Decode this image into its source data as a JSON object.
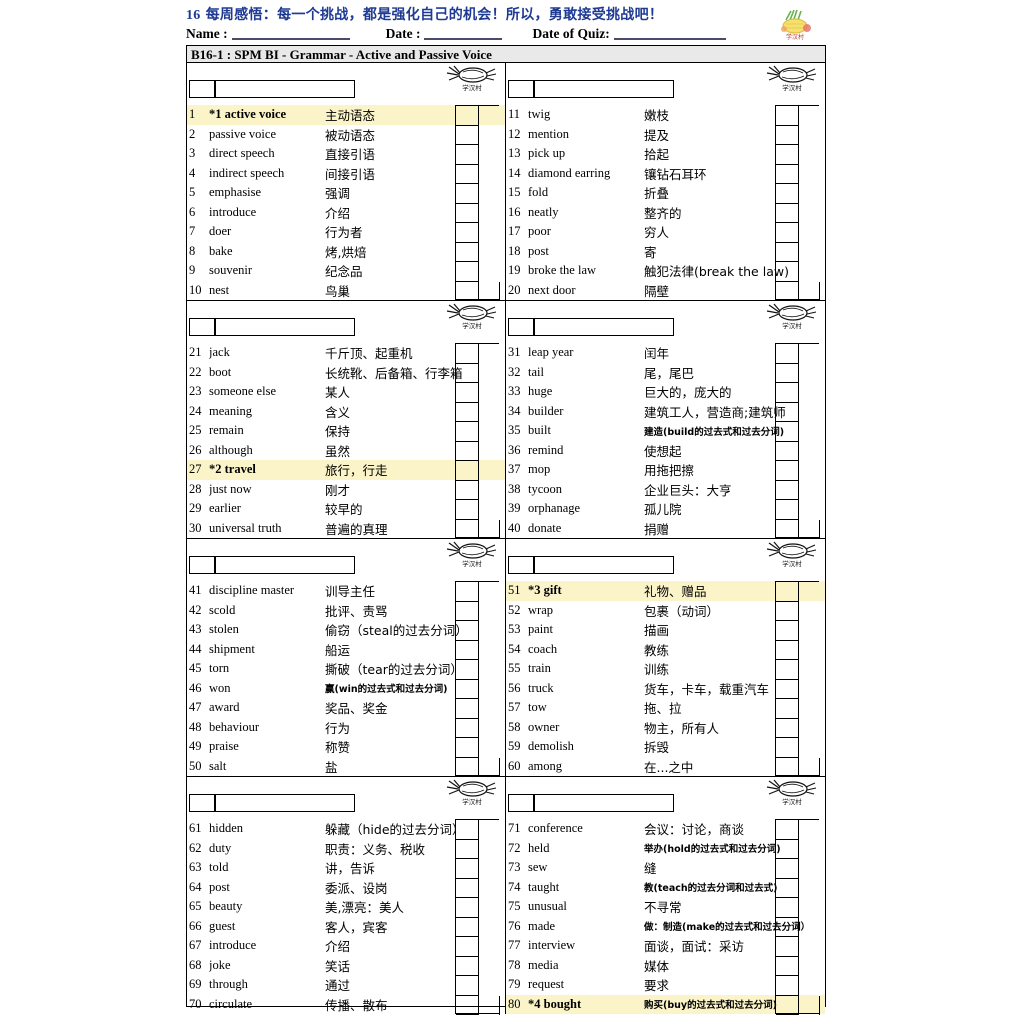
{
  "banner": {
    "number": "16",
    "text": "每周感悟：每一个挑战，都是强化自己的机会！所以，勇敢接受挑战吧！",
    "color": "#1F3A93"
  },
  "idline": {
    "name_label": "Name :",
    "date_label": "Date :",
    "quiz_label": "Date of Quiz:",
    "name_value": "",
    "date_value": "",
    "quiz_value": ""
  },
  "logo": {
    "name": "pineapple-logo",
    "caption": "学汉村"
  },
  "sheet": {
    "title": "B16-1 : SPM BI - Grammar - Active and Passive Voice",
    "header_box_small": "",
    "header_box_large": "",
    "watermark_caption": "学汉村"
  },
  "highlight_color": "#faf4c8",
  "blocks": [
    {
      "left": {
        "rows": [
          {
            "n": "1",
            "en": "*1 active voice",
            "zh": "主动语态",
            "hl": true,
            "bold": true,
            "small": false
          },
          {
            "n": "2",
            "en": "passive voice",
            "zh": "被动语态",
            "hl": false,
            "bold": false,
            "small": false
          },
          {
            "n": "3",
            "en": "direct speech",
            "zh": "直接引语",
            "hl": false,
            "bold": false,
            "small": false
          },
          {
            "n": "4",
            "en": "indirect speech",
            "zh": "间接引语",
            "hl": false,
            "bold": false,
            "small": false
          },
          {
            "n": "5",
            "en": "emphasise",
            "zh": "强调",
            "hl": false,
            "bold": false,
            "small": false
          },
          {
            "n": "6",
            "en": "introduce",
            "zh": "介绍",
            "hl": false,
            "bold": false,
            "small": false
          },
          {
            "n": "7",
            "en": "doer",
            "zh": "行为者",
            "hl": false,
            "bold": false,
            "small": false
          },
          {
            "n": "8",
            "en": "bake",
            "zh": "烤,烘焙",
            "hl": false,
            "bold": false,
            "small": false
          },
          {
            "n": "9",
            "en": "souvenir",
            "zh": "纪念品",
            "hl": false,
            "bold": false,
            "small": false
          },
          {
            "n": "10",
            "en": "nest",
            "zh": "鸟巢",
            "hl": false,
            "bold": false,
            "small": false
          }
        ]
      },
      "right": {
        "rows": [
          {
            "n": "11",
            "en": "twig",
            "zh": "嫩枝",
            "hl": false,
            "bold": false,
            "small": false
          },
          {
            "n": "12",
            "en": "mention",
            "zh": "提及",
            "hl": false,
            "bold": false,
            "small": false
          },
          {
            "n": "13",
            "en": "pick up",
            "zh": "拾起",
            "hl": false,
            "bold": false,
            "small": false
          },
          {
            "n": "14",
            "en": "diamond earring",
            "zh": "镶钻石耳环",
            "hl": false,
            "bold": false,
            "small": false
          },
          {
            "n": "15",
            "en": "fold",
            "zh": "折叠",
            "hl": false,
            "bold": false,
            "small": false
          },
          {
            "n": "16",
            "en": "neatly",
            "zh": "整齐的",
            "hl": false,
            "bold": false,
            "small": false
          },
          {
            "n": "17",
            "en": "poor",
            "zh": "穷人",
            "hl": false,
            "bold": false,
            "small": false
          },
          {
            "n": "18",
            "en": "post",
            "zh": "寄",
            "hl": false,
            "bold": false,
            "small": false
          },
          {
            "n": "19",
            "en": "broke the law",
            "zh": "触犯法律(break the law)",
            "hl": false,
            "bold": false,
            "small": false
          },
          {
            "n": "20",
            "en": "next door",
            "zh": "隔壁",
            "hl": false,
            "bold": false,
            "small": false
          }
        ]
      }
    },
    {
      "left": {
        "rows": [
          {
            "n": "21",
            "en": "jack",
            "zh": "千斤顶、起重机",
            "hl": false,
            "bold": false,
            "small": false
          },
          {
            "n": "22",
            "en": "boot",
            "zh": "长统靴、后备箱、行李箱",
            "hl": false,
            "bold": false,
            "small": false
          },
          {
            "n": "23",
            "en": "someone else",
            "zh": "某人",
            "hl": false,
            "bold": false,
            "small": false
          },
          {
            "n": "24",
            "en": "meaning",
            "zh": "含义",
            "hl": false,
            "bold": false,
            "small": false
          },
          {
            "n": "25",
            "en": "remain",
            "zh": "保持",
            "hl": false,
            "bold": false,
            "small": false
          },
          {
            "n": "26",
            "en": "although",
            "zh": "虽然",
            "hl": false,
            "bold": false,
            "small": false
          },
          {
            "n": "27",
            "en": "*2 travel",
            "zh": "旅行，行走",
            "hl": true,
            "bold": true,
            "small": false
          },
          {
            "n": "28",
            "en": "just now",
            "zh": "刚才",
            "hl": false,
            "bold": false,
            "small": false
          },
          {
            "n": "29",
            "en": "earlier",
            "zh": "较早的",
            "hl": false,
            "bold": false,
            "small": false
          },
          {
            "n": "30",
            "en": "universal truth",
            "zh": "普遍的真理",
            "hl": false,
            "bold": false,
            "small": false
          }
        ]
      },
      "right": {
        "rows": [
          {
            "n": "31",
            "en": "leap year",
            "zh": "闰年",
            "hl": false,
            "bold": false,
            "small": false
          },
          {
            "n": "32",
            "en": "tail",
            "zh": "尾，尾巴",
            "hl": false,
            "bold": false,
            "small": false
          },
          {
            "n": "33",
            "en": "huge",
            "zh": "巨大的，庞大的",
            "hl": false,
            "bold": false,
            "small": false
          },
          {
            "n": "34",
            "en": "builder",
            "zh": "建筑工人，营造商;建筑师",
            "hl": false,
            "bold": false,
            "small": false
          },
          {
            "n": "35",
            "en": "built",
            "zh": "建造(build的过去式和过去分词)",
            "hl": false,
            "bold": false,
            "small": true
          },
          {
            "n": "36",
            "en": "remind",
            "zh": "使想起",
            "hl": false,
            "bold": false,
            "small": false
          },
          {
            "n": "37",
            "en": "mop",
            "zh": "用拖把擦",
            "hl": false,
            "bold": false,
            "small": false
          },
          {
            "n": "38",
            "en": "tycoon",
            "zh": "企业巨头：大亨",
            "hl": false,
            "bold": false,
            "small": false
          },
          {
            "n": "39",
            "en": "orphanage",
            "zh": " 孤儿院",
            "hl": false,
            "bold": false,
            "small": false
          },
          {
            "n": "40",
            "en": "donate",
            "zh": "捐赠",
            "hl": false,
            "bold": false,
            "small": false
          }
        ]
      }
    },
    {
      "left": {
        "rows": [
          {
            "n": "41",
            "en": "discipline master",
            "zh": "训导主任",
            "hl": false,
            "bold": false,
            "small": false
          },
          {
            "n": "42",
            "en": "scold",
            "zh": "批评、责骂",
            "hl": false,
            "bold": false,
            "small": false
          },
          {
            "n": "43",
            "en": "stolen",
            "zh": "偷窃（steal的过去分词）",
            "hl": false,
            "bold": false,
            "small": false
          },
          {
            "n": "44",
            "en": "shipment",
            "zh": "船运",
            "hl": false,
            "bold": false,
            "small": false
          },
          {
            "n": "45",
            "en": "torn",
            "zh": "撕破（tear的过去分词）",
            "hl": false,
            "bold": false,
            "small": false
          },
          {
            "n": "46",
            "en": "won",
            "zh": "赢(win的过去式和过去分词)",
            "hl": false,
            "bold": false,
            "small": true
          },
          {
            "n": "47",
            "en": "award",
            "zh": "奖品、奖金",
            "hl": false,
            "bold": false,
            "small": false
          },
          {
            "n": "48",
            "en": "behaviour",
            "zh": "行为",
            "hl": false,
            "bold": false,
            "small": false
          },
          {
            "n": "49",
            "en": "praise",
            "zh": "称赞",
            "hl": false,
            "bold": false,
            "small": false
          },
          {
            "n": "50",
            "en": "salt",
            "zh": "盐",
            "hl": false,
            "bold": false,
            "small": false
          }
        ]
      },
      "right": {
        "rows": [
          {
            "n": "51",
            "en": "*3 gift",
            "zh": "礼物、赠品",
            "hl": true,
            "bold": true,
            "small": false
          },
          {
            "n": "52",
            "en": "wrap",
            "zh": "包裹（动词）",
            "hl": false,
            "bold": false,
            "small": false
          },
          {
            "n": "53",
            "en": "paint",
            "zh": "描画",
            "hl": false,
            "bold": false,
            "small": false
          },
          {
            "n": "54",
            "en": "coach",
            "zh": "教练",
            "hl": false,
            "bold": false,
            "small": false
          },
          {
            "n": "55",
            "en": "train",
            "zh": "训练",
            "hl": false,
            "bold": false,
            "small": false
          },
          {
            "n": "56",
            "en": "truck",
            "zh": "货车，卡车，载重汽车",
            "hl": false,
            "bold": false,
            "small": false
          },
          {
            "n": "57",
            "en": "tow",
            "zh": "拖、拉",
            "hl": false,
            "bold": false,
            "small": false
          },
          {
            "n": "58",
            "en": "owner",
            "zh": "物主，所有人",
            "hl": false,
            "bold": false,
            "small": false
          },
          {
            "n": "59",
            "en": "demolish",
            "zh": "拆毁",
            "hl": false,
            "bold": false,
            "small": false
          },
          {
            "n": "60",
            "en": "among",
            "zh": "在...之中",
            "hl": false,
            "bold": false,
            "small": false
          }
        ]
      }
    },
    {
      "left": {
        "rows": [
          {
            "n": "61",
            "en": "hidden",
            "zh": "躲藏（hide的过去分词）",
            "hl": false,
            "bold": false,
            "small": false
          },
          {
            "n": "62",
            "en": "duty",
            "zh": "职责：义务、税收",
            "hl": false,
            "bold": false,
            "small": false
          },
          {
            "n": "63",
            "en": "told",
            "zh": "讲，告诉",
            "hl": false,
            "bold": false,
            "small": false
          },
          {
            "n": "64",
            "en": "post",
            "zh": "委派、设岗",
            "hl": false,
            "bold": false,
            "small": false
          },
          {
            "n": "65",
            "en": "beauty",
            "zh": "美,漂亮：美人",
            "hl": false,
            "bold": false,
            "small": false
          },
          {
            "n": "66",
            "en": "guest",
            "zh": "客人，宾客",
            "hl": false,
            "bold": false,
            "small": false
          },
          {
            "n": "67",
            "en": "introduce",
            "zh": "介绍",
            "hl": false,
            "bold": false,
            "small": false
          },
          {
            "n": "68",
            "en": "joke",
            "zh": "笑话",
            "hl": false,
            "bold": false,
            "small": false
          },
          {
            "n": "69",
            "en": "through",
            "zh": "通过",
            "hl": false,
            "bold": false,
            "small": false
          },
          {
            "n": "70",
            "en": "circulate",
            "zh": "传播、散布",
            "hl": false,
            "bold": false,
            "small": false
          }
        ]
      },
      "right": {
        "rows": [
          {
            "n": "71",
            "en": "conference",
            "zh": "会议：讨论，商谈",
            "hl": false,
            "bold": false,
            "small": false
          },
          {
            "n": "72",
            "en": "held",
            "zh": "举办(hold的过去式和过去分词)",
            "hl": false,
            "bold": false,
            "small": true
          },
          {
            "n": "73",
            "en": "sew",
            "zh": "缝",
            "hl": false,
            "bold": false,
            "small": false
          },
          {
            "n": "74",
            "en": "taught",
            "zh": "教(teach的过去分词和过去式)",
            "hl": false,
            "bold": false,
            "small": true
          },
          {
            "n": "75",
            "en": "unusual",
            "zh": "不寻常",
            "hl": false,
            "bold": false,
            "small": false
          },
          {
            "n": "76",
            "en": "made",
            "zh": "做：制造(make的过去式和过去分词）",
            "hl": false,
            "bold": false,
            "small": true
          },
          {
            "n": "77",
            "en": "interview",
            "zh": "面谈，面试：采访",
            "hl": false,
            "bold": false,
            "small": false
          },
          {
            "n": "78",
            "en": "media",
            "zh": "媒体",
            "hl": false,
            "bold": false,
            "small": false
          },
          {
            "n": "79",
            "en": "request",
            "zh": "要求",
            "hl": false,
            "bold": false,
            "small": false
          },
          {
            "n": "80",
            "en": "*4 bought",
            "zh": "购买(buy的过去式和过去分词)",
            "hl": true,
            "bold": true,
            "small": true
          }
        ]
      }
    }
  ]
}
